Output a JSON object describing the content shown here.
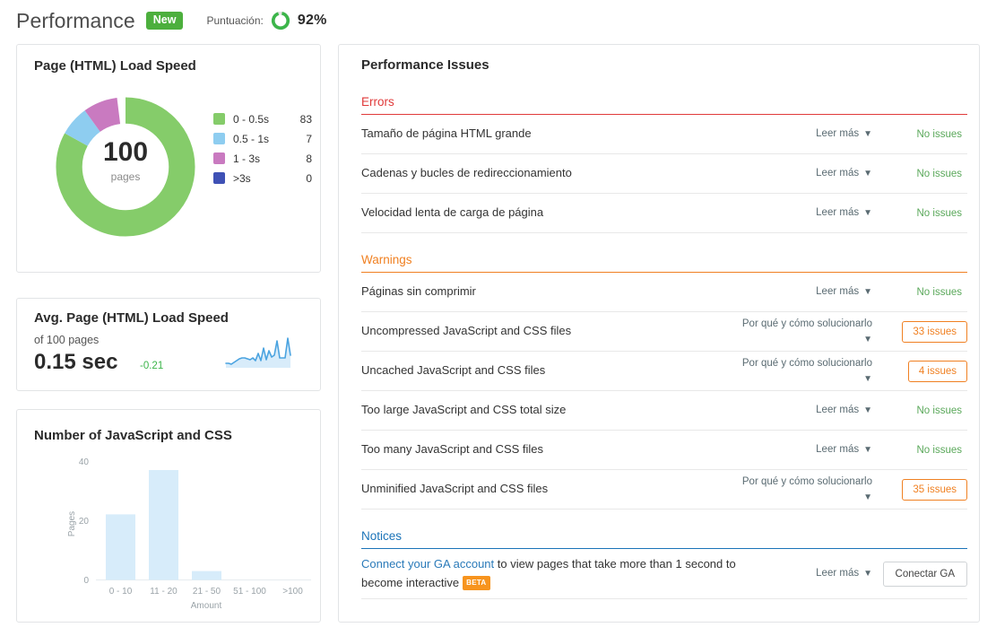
{
  "header": {
    "title": "Performance",
    "new_badge": "New",
    "score_label": "Puntuación:",
    "score_value": "92%",
    "score_pct": 92,
    "ring_color": "#3cb54a",
    "new_badge_color": "#4caf3d"
  },
  "load_speed_card": {
    "title": "Page (HTML) Load Speed",
    "center_number": "100",
    "center_sub": "pages"
  },
  "avg_card": {
    "title": "Avg. Page (HTML) Load Speed",
    "subtitle": "of 100 pages",
    "value": "0.15 sec",
    "delta": "-0.21",
    "delta_color": "#3cb54a"
  },
  "bar_card": {
    "title": "Number of JavaScript and CSS"
  },
  "issues_panel": {
    "title": "Performance Issues",
    "sections": [
      {
        "name": "Errors",
        "color": "#e03a3a",
        "rows": [
          {
            "label": "Tamaño de página HTML grande",
            "action": "Leer más",
            "status_type": "none",
            "status": "No issues"
          },
          {
            "label": "Cadenas y bucles de redireccionamiento",
            "action": "Leer más",
            "status_type": "none",
            "status": "No issues"
          },
          {
            "label": "Velocidad lenta de carga de página",
            "action": "Leer más",
            "status_type": "none",
            "status": "No issues"
          }
        ]
      },
      {
        "name": "Warnings",
        "color": "#f08022",
        "rows": [
          {
            "label": "Páginas sin comprimir",
            "action": "Leer más",
            "status_type": "none",
            "status": "No issues"
          },
          {
            "label": "Uncompressed JavaScript and CSS files",
            "action": "Por qué y cómo solucionarlo",
            "status_type": "badge",
            "status": "33 issues"
          },
          {
            "label": "Uncached JavaScript and CSS files",
            "action": "Por qué y cómo solucionarlo",
            "status_type": "badge",
            "status": "4 issues"
          },
          {
            "label": "Too large JavaScript and CSS total size",
            "action": "Leer más",
            "status_type": "none",
            "status": "No issues"
          },
          {
            "label": "Too many JavaScript and CSS files",
            "action": "Leer más",
            "status_type": "none",
            "status": "No issues"
          },
          {
            "label": "Unminified JavaScript and CSS files",
            "action": "Por qué y cómo solucionarlo",
            "status_type": "badge",
            "status": "35 issues"
          }
        ]
      },
      {
        "name": "Notices",
        "color": "#1a73b8",
        "rows": [
          {
            "label_link": "Connect your GA account",
            "label_rest": " to view pages that take more than 1 second to become interactive",
            "label_badge": "BETA",
            "action": "Leer más",
            "status_type": "button",
            "status": "Conectar GA"
          }
        ]
      }
    ]
  },
  "chart_data": [
    {
      "type": "pie",
      "title": "Page (HTML) Load Speed",
      "center_label": "100",
      "center_sublabel": "pages",
      "categories": [
        "0 - 0.5s",
        "0.5 - 1s",
        "1 - 3s",
        ">3s"
      ],
      "values": [
        83,
        7,
        8,
        0
      ],
      "colors": [
        "#85cc6a",
        "#8ecdf0",
        "#c97ac0",
        "#3f51b5"
      ],
      "total": 100,
      "legend": "right"
    },
    {
      "type": "area",
      "title": "Avg. Page (HTML) Load Speed",
      "values": [
        2,
        1.6,
        1.5,
        1.8,
        2.6,
        3.0,
        3.0,
        2.9,
        2.6,
        2.4,
        3.4,
        2.5,
        4.4,
        2.6,
        5.2,
        2.7,
        4.3,
        3.2,
        3.7,
        6.2,
        3.0,
        3.0,
        3.0,
        6.4,
        3.2
      ],
      "line_color": "#4aa3e0",
      "fill_color": "#d8ecfa",
      "grid": false
    },
    {
      "type": "bar",
      "title": "Number of JavaScript and CSS",
      "categories": [
        "0 - 10",
        "11 - 20",
        "21 - 50",
        "51 - 100",
        ">100"
      ],
      "values": [
        22,
        37,
        3,
        0,
        0
      ],
      "xlabel": "Amount",
      "ylabel": "Pages",
      "ylim": [
        0,
        40
      ],
      "yticks": [
        0,
        20,
        40
      ],
      "bar_color": "#d7ecfa",
      "grid": false
    }
  ]
}
